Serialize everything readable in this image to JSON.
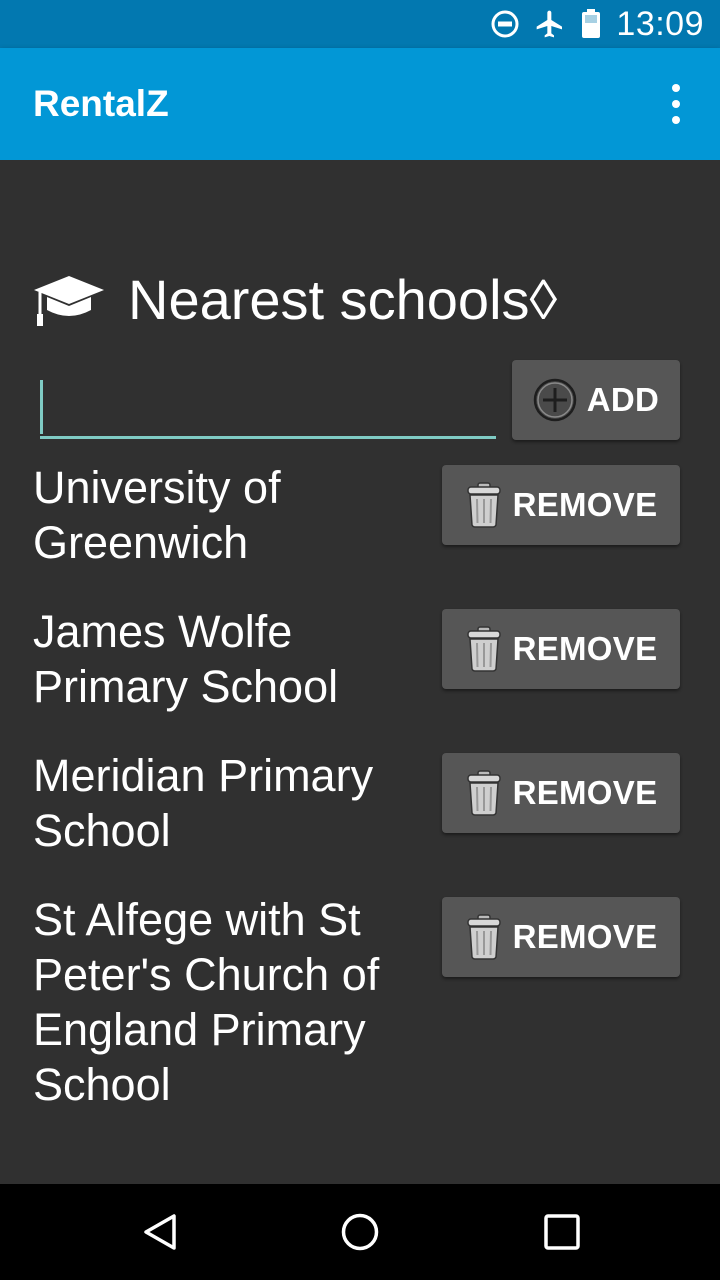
{
  "status_bar": {
    "time": "13:09",
    "icons": [
      "do-not-disturb-icon",
      "airplane-mode-icon",
      "battery-icon"
    ]
  },
  "app_bar": {
    "title": "RentalZ",
    "menu_icon": "overflow-menu-icon"
  },
  "section": {
    "icon": "graduation-cap-icon",
    "title": "Nearest schools◊"
  },
  "add_form": {
    "input_value": "",
    "input_placeholder": "",
    "add_label": "ADD",
    "add_icon": "plus-circle-icon"
  },
  "schools": [
    {
      "name": "University of Greenwich",
      "remove_label": "REMOVE"
    },
    {
      "name": "James Wolfe Primary School",
      "remove_label": "REMOVE"
    },
    {
      "name": "Meridian Primary School",
      "remove_label": "REMOVE"
    },
    {
      "name": "St Alfege with St Peter's Church of England Primary School",
      "remove_label": "REMOVE"
    }
  ],
  "nav_bar": {
    "buttons": [
      "back-icon",
      "home-icon",
      "recents-icon"
    ]
  },
  "colors": {
    "status_bar": "#0278b0",
    "app_bar": "#0297d6",
    "background": "#303030",
    "button": "#565656",
    "accent": "#7fcbc4"
  }
}
